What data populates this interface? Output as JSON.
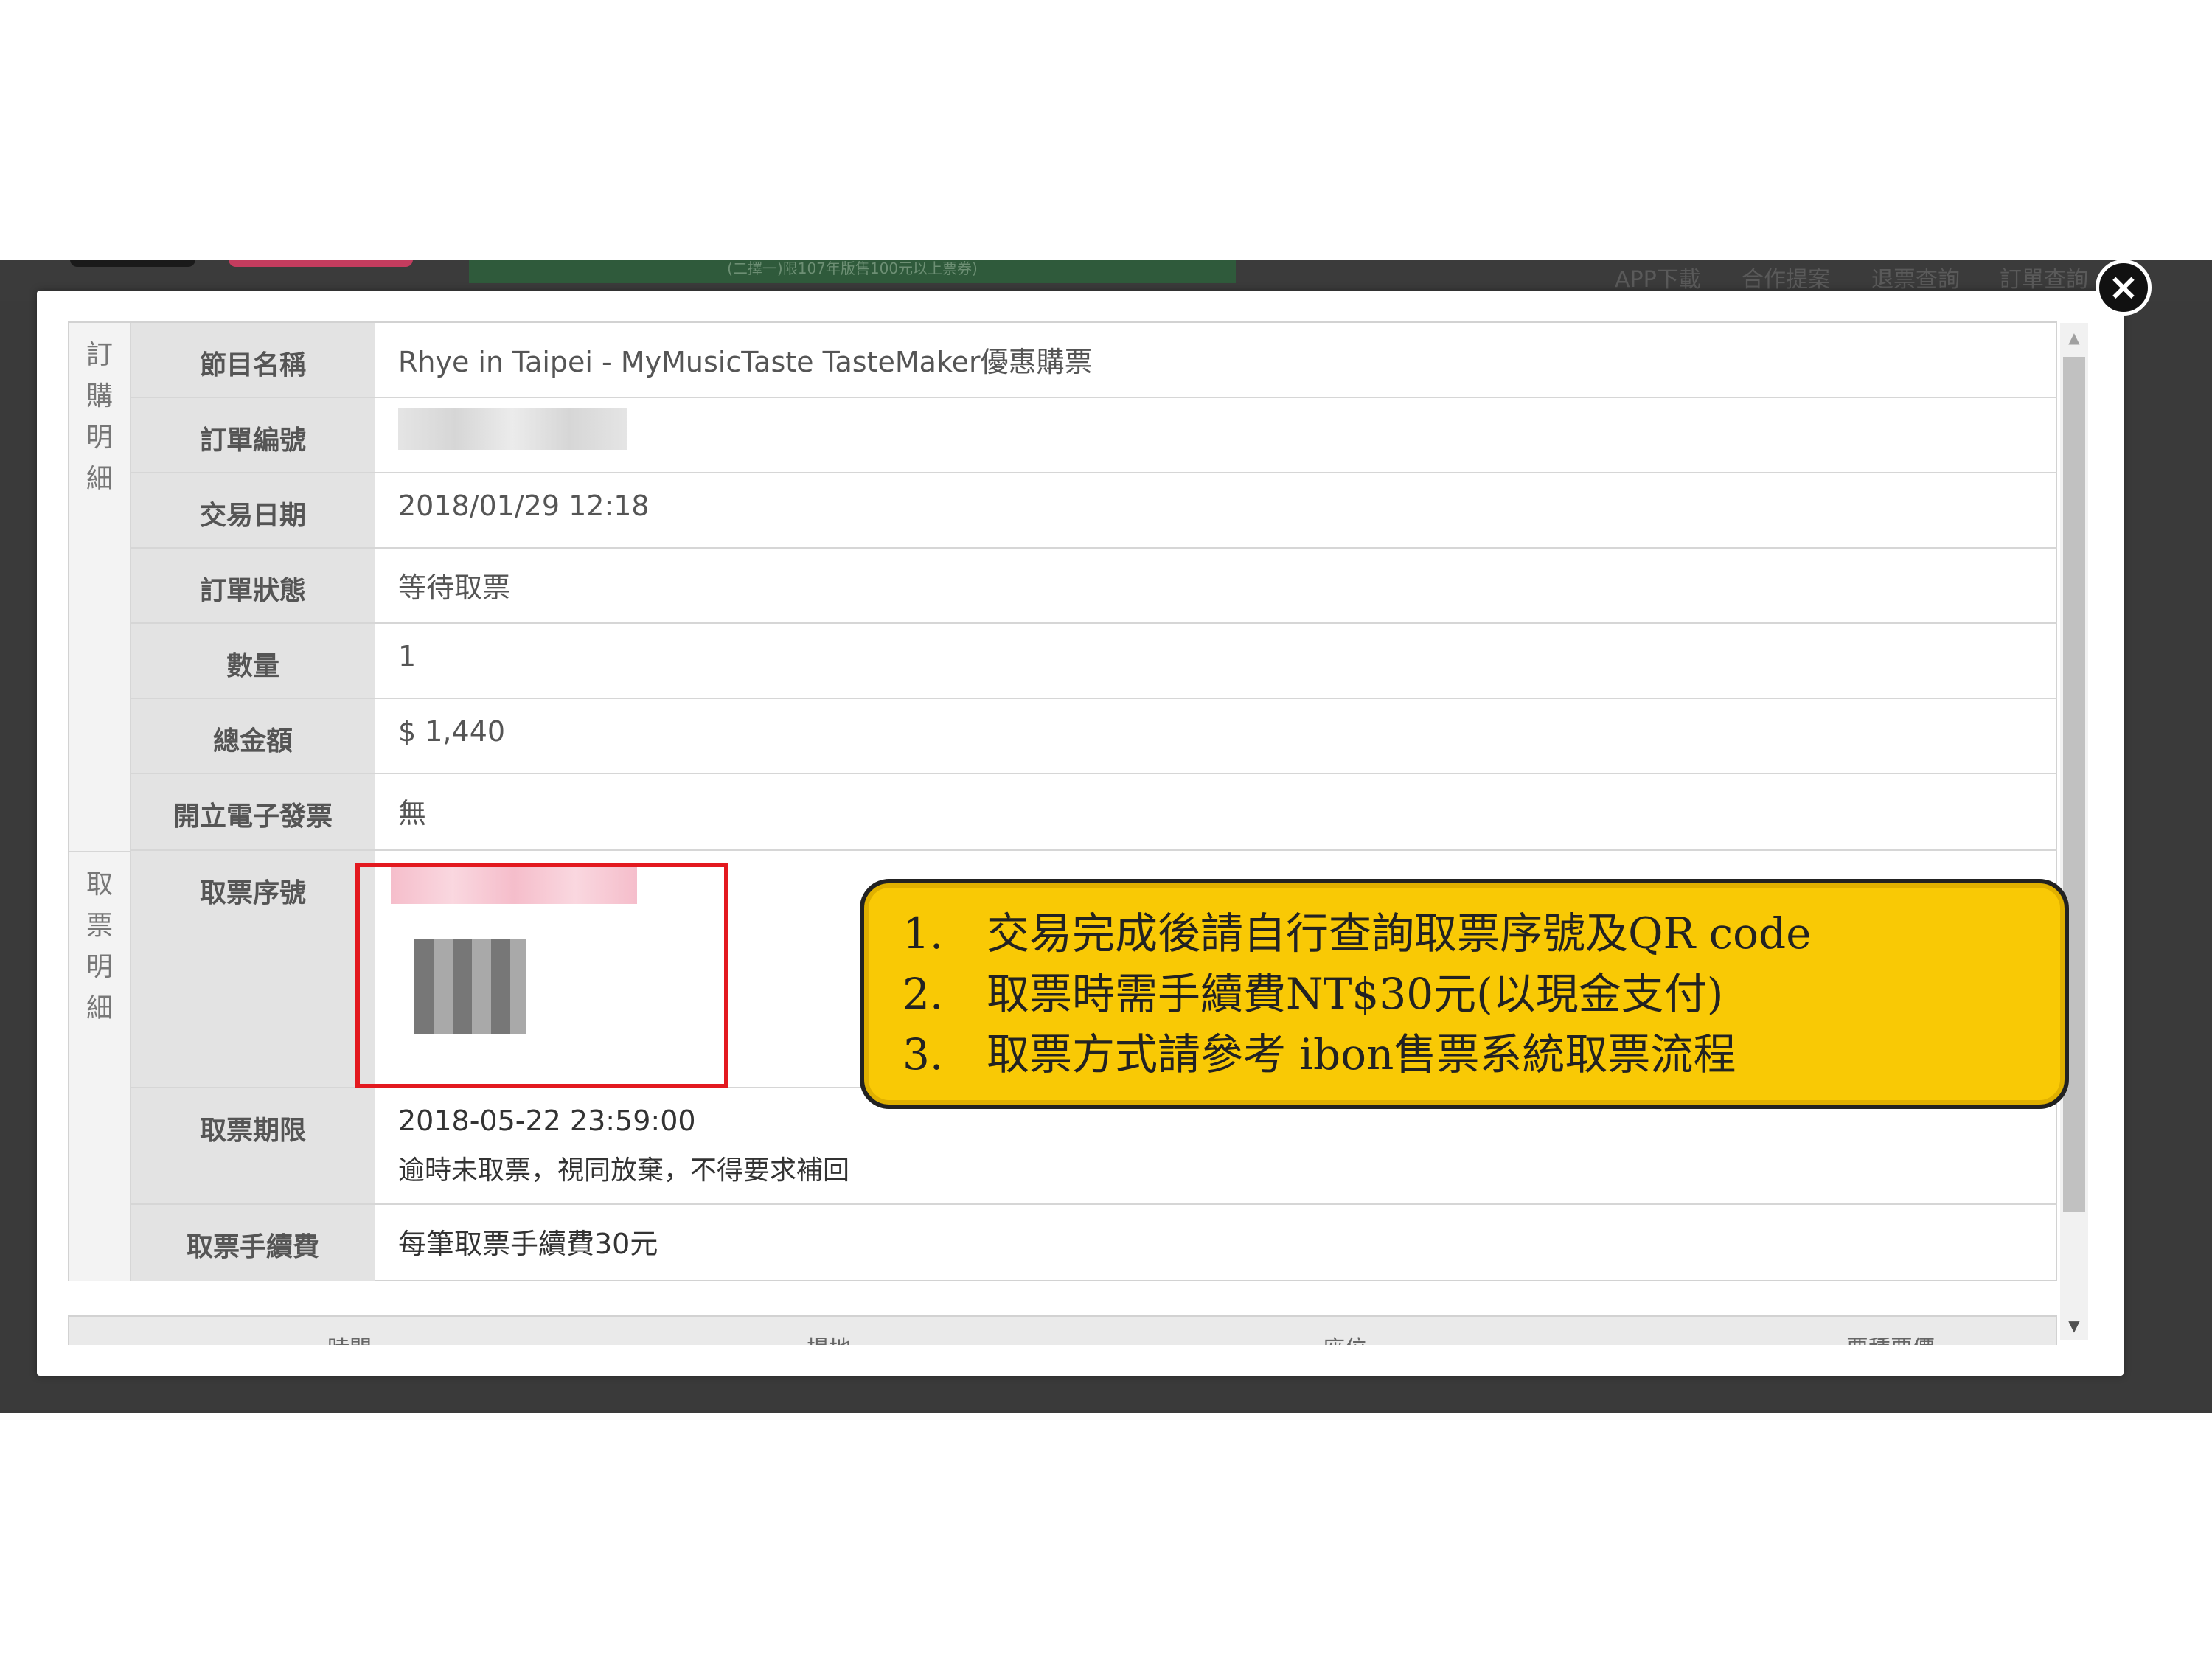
{
  "background": {
    "nav_links": [
      "APP下載",
      "合作提案",
      "退票查詢",
      "訂單查詢"
    ],
    "banner_text": "(二擇一)限107年版售100元以上票券)"
  },
  "modal": {
    "close_icon": "×",
    "sections": {
      "order": "訂購明細",
      "ticket": "取票明細"
    },
    "rows": [
      {
        "label": "節目名稱",
        "value": "Rhye in Taipei - MyMusicTaste TasteMaker優惠購票"
      },
      {
        "label": "訂單編號",
        "value": ""
      },
      {
        "label": "交易日期",
        "value": "2018/01/29 12:18"
      },
      {
        "label": "訂單狀態",
        "value": "等待取票"
      },
      {
        "label": "數量",
        "value": "1"
      },
      {
        "label": "總金額",
        "value": " $ 1,440"
      },
      {
        "label": "開立電子發票",
        "value": "無"
      },
      {
        "label": "取票序號",
        "value": ""
      },
      {
        "label": "取票期限",
        "value": "2018-05-22 23:59:00",
        "note": "逾時未取票，視同放棄，不得要求補回"
      },
      {
        "label": "取票手續費",
        "value": "每筆取票手續費30元"
      }
    ],
    "bottom_header": [
      "時間",
      "場地",
      "座位",
      "票種票價"
    ]
  },
  "callout": {
    "items": [
      {
        "num": "1.",
        "text": "交易完成後請自行查詢取票序號及QR code"
      },
      {
        "num": "2.",
        "text": "取票時需手續費NT$30元(以現金支付)"
      },
      {
        "num": "3.",
        "text": "取票方式請參考 ibon售票系統取票流程"
      }
    ]
  },
  "colors": {
    "highlight_border": "#e3191f",
    "callout_fill": "#f9c905",
    "label_bg": "#e3e3e3"
  }
}
